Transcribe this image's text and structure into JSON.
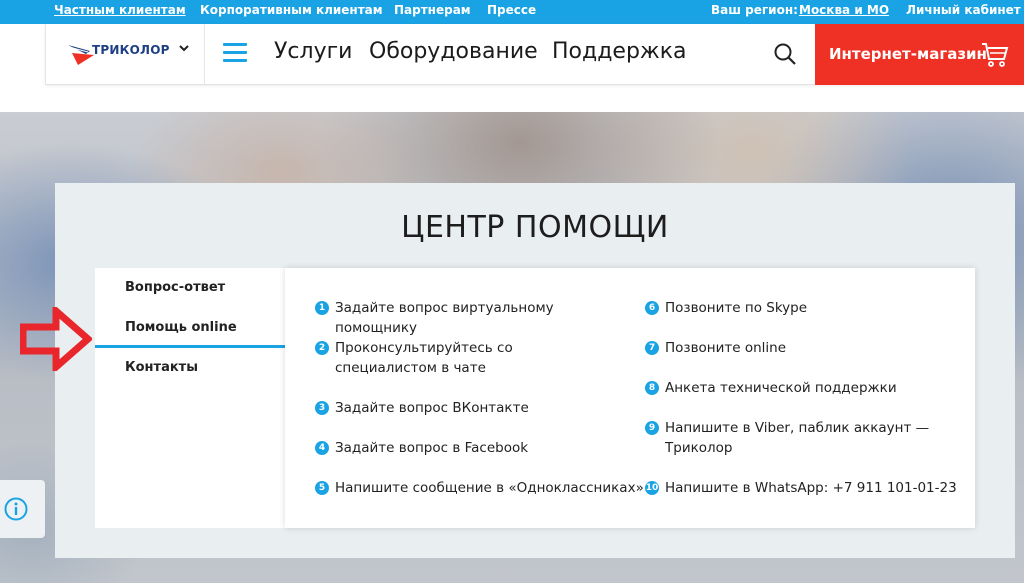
{
  "topbar": {
    "private": "Частным клиентам",
    "corporate": "Корпоративным клиентам",
    "partners": "Партнерам",
    "press": "Прессе",
    "region_label": "Ваш регион:",
    "region_value": "Москва и МО",
    "cabinet": "Личный кабинет"
  },
  "header": {
    "logo_text": "ТРИКОЛОР",
    "nav": [
      "Услуги",
      "Оборудование",
      "Поддержка"
    ],
    "shop": "Интернет-магазин"
  },
  "help": {
    "title": "ЦЕНТР ПОМОЩИ",
    "side": [
      "Вопрос-ответ",
      "Помощь online",
      "Контакты"
    ],
    "left_items": [
      {
        "num": "1",
        "text": "Задайте вопрос виртуальному помощнику"
      },
      {
        "num": "2",
        "text": "Проконсультируйтесь со специалистом в чате"
      },
      {
        "num": "3",
        "text": "Задайте вопрос ВКонтакте"
      },
      {
        "num": "4",
        "text": "Задайте вопрос в Facebook"
      },
      {
        "num": "5",
        "text": "Напишите сообщение в «Одноклассниках»"
      }
    ],
    "right_items": [
      {
        "num": "6",
        "text": "Позвоните по Skype"
      },
      {
        "num": "7",
        "text": "Позвоните online"
      },
      {
        "num": "8",
        "text": "Анкета технической поддержки"
      },
      {
        "num": "9",
        "text": "Напишите в Viber, паблик аккаунт — Триколор"
      },
      {
        "num": "10",
        "text": "Напишите в WhatsApp: +7 911 101-01-23"
      }
    ]
  },
  "colors": {
    "accent": "#1aa3e4",
    "shop": "#ee3124",
    "arrow": "#e8262b"
  },
  "icons": [
    "chevron-down-icon",
    "menu-icon",
    "search-icon",
    "cart-icon",
    "arrow-right-icon",
    "info-icon"
  ]
}
